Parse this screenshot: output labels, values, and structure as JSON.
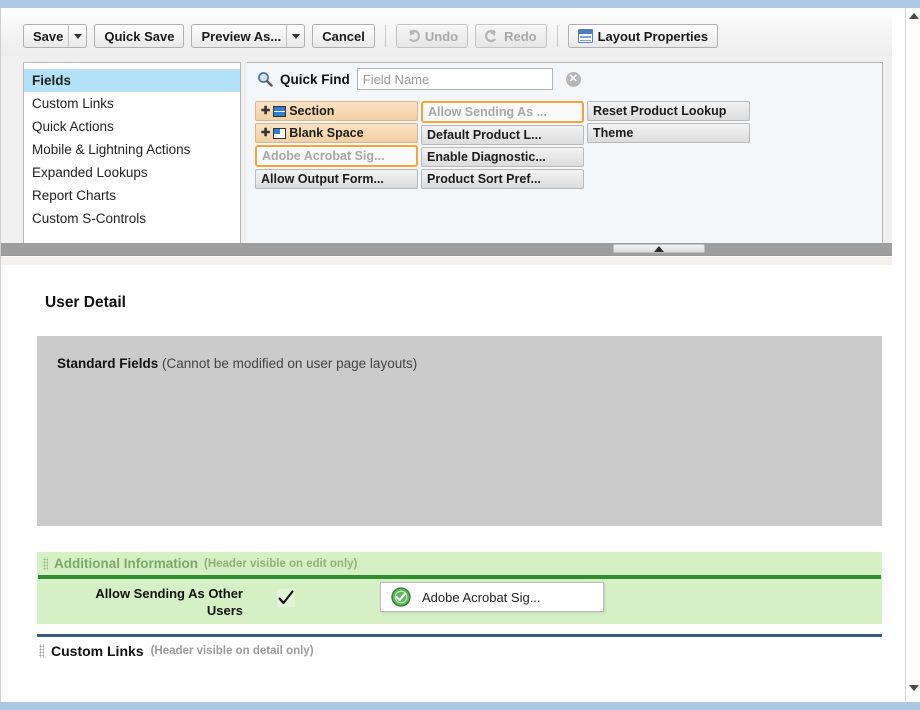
{
  "toolbar": {
    "save_label": "Save",
    "quick_save_label": "Quick Save",
    "preview_as_label": "Preview As...",
    "cancel_label": "Cancel",
    "undo_label": "Undo",
    "redo_label": "Redo",
    "layout_properties_label": "Layout Properties"
  },
  "sidebar": {
    "items": [
      {
        "label": "Fields",
        "active": true
      },
      {
        "label": "Custom Links",
        "active": false
      },
      {
        "label": "Quick Actions",
        "active": false
      },
      {
        "label": "Mobile & Lightning Actions",
        "active": false
      },
      {
        "label": "Expanded Lookups",
        "active": false
      },
      {
        "label": "Report Charts",
        "active": false
      },
      {
        "label": "Custom S-Controls",
        "active": false
      }
    ]
  },
  "quick_find": {
    "label": "Quick Find",
    "placeholder": "Field Name",
    "value": "",
    "clear_glyph": "✕",
    "icon": "search-icon"
  },
  "palette": {
    "columns": [
      {
        "tiles": [
          {
            "label": "Section",
            "style": "special",
            "icon": "section-icon",
            "plus": "✚"
          },
          {
            "label": "Blank Space",
            "style": "special",
            "icon": "blank-space-icon",
            "plus": "✚"
          },
          {
            "label": "Adobe Acrobat Sig...",
            "style": "highlighted"
          },
          {
            "label": "Allow Output Form...",
            "style": "normal"
          }
        ]
      },
      {
        "tiles": [
          {
            "label": "Allow Sending As ...",
            "style": "highlighted"
          },
          {
            "label": "Default Product L...",
            "style": "normal"
          },
          {
            "label": "Enable Diagnostic...",
            "style": "normal"
          },
          {
            "label": "Product Sort Pref...",
            "style": "normal"
          }
        ]
      },
      {
        "tiles": [
          {
            "label": "Reset Product Lookup",
            "style": "normal"
          },
          {
            "label": "Theme",
            "style": "normal"
          }
        ]
      }
    ]
  },
  "preview": {
    "detail_title": "User Detail",
    "standard_fields": {
      "title": "Standard Fields",
      "note": "(Cannot be modified on user page layouts)"
    },
    "additional_information": {
      "title": "Additional Information",
      "note": "(Header visible on edit only)",
      "field_label": "Allow Sending As Other Users",
      "field_value_icon": "checkmark-icon",
      "drag_tile_label": "Adobe Acrobat Sig...",
      "drag_tile_icon": "green-check-circle-icon"
    },
    "custom_links": {
      "title": "Custom Links",
      "note": "(Header visible on detail only)"
    }
  },
  "colors": {
    "accent_highlight": "#f6a33a",
    "section_tile": "#f2cfa5",
    "additional_info_bg": "#d5f0c4",
    "additional_info_rule": "#2f8c2f",
    "standard_fields_bg": "#cbcbcb",
    "sidebar_active": "#b3e1f7",
    "page_bg": "#aec7e3"
  }
}
